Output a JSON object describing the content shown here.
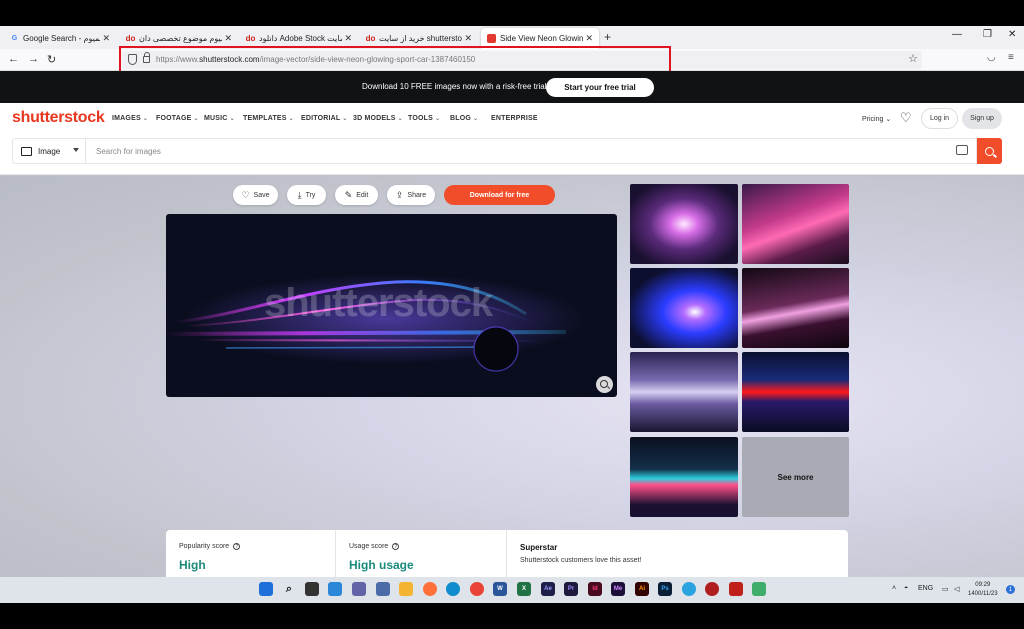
{
  "browser": {
    "tabs": [
      {
        "label": "Google Search - دانلود پریمیوم",
        "favicon": "google-icon",
        "active": false
      },
      {
        "label": "دانلود پریمیوم موضوع تخصصی دان",
        "favicon": "do-icon",
        "active": false
      },
      {
        "label": "دانلود Adobe Stock فقط از سایت",
        "favicon": "do-icon",
        "active": false
      },
      {
        "label": "خرید از سایت shutterstock images",
        "favicon": "do-icon",
        "active": false
      },
      {
        "label": "Side View Neon Glowing Sport",
        "favicon": "shutterstock-icon",
        "active": true
      }
    ],
    "new_tab": "+",
    "window_controls": {
      "minimize": "—",
      "maximize": "❐",
      "close": "✕"
    },
    "nav": {
      "back": "←",
      "forward": "→",
      "reload": "↻"
    },
    "url": {
      "prefix": "https://www.",
      "domain": "shutterstock.com",
      "path": "/image-vector/side-view-neon-glowing-sport-car-1387460150"
    },
    "bookmark_star": "☆",
    "toolbar_right": {
      "pocket": "◡",
      "menu": "≡"
    }
  },
  "promo": {
    "text": "Download 10 FREE images now with a risk-free trial.",
    "button": "Start your free trial"
  },
  "nav": {
    "logo": "shutterstock",
    "menu": [
      "IMAGES",
      "FOOTAGE",
      "MUSIC",
      "TEMPLATES",
      "EDITORIAL",
      "3D MODELS",
      "TOOLS",
      "BLOG",
      "ENTERPRISE"
    ],
    "pricing": "Pricing",
    "login": "Log in",
    "signup": "Sign up"
  },
  "search": {
    "type": "Image",
    "placeholder": "Search for images"
  },
  "actions": {
    "save": "Save",
    "try": "Try",
    "edit": "Edit",
    "share": "Share",
    "download": "Download for free"
  },
  "main_image": {
    "watermark": "shutterstock"
  },
  "related": {
    "see_more": "See more"
  },
  "stats": {
    "popularity_label": "Popularity score",
    "popularity_value": "High",
    "usage_label": "Usage score",
    "usage_value": "High usage",
    "superstar_title": "Superstar",
    "superstar_desc": "Shutterstock customers love this asset!"
  },
  "taskbar": {
    "tray_lang": "ENG",
    "time": "09:29",
    "date": "1400/11/23",
    "notifications": "1"
  },
  "colors": {
    "brand": "#e8381f",
    "accent": "#f24d2a",
    "score": "#1a8a7a",
    "highlight_box": "#e0141e"
  }
}
